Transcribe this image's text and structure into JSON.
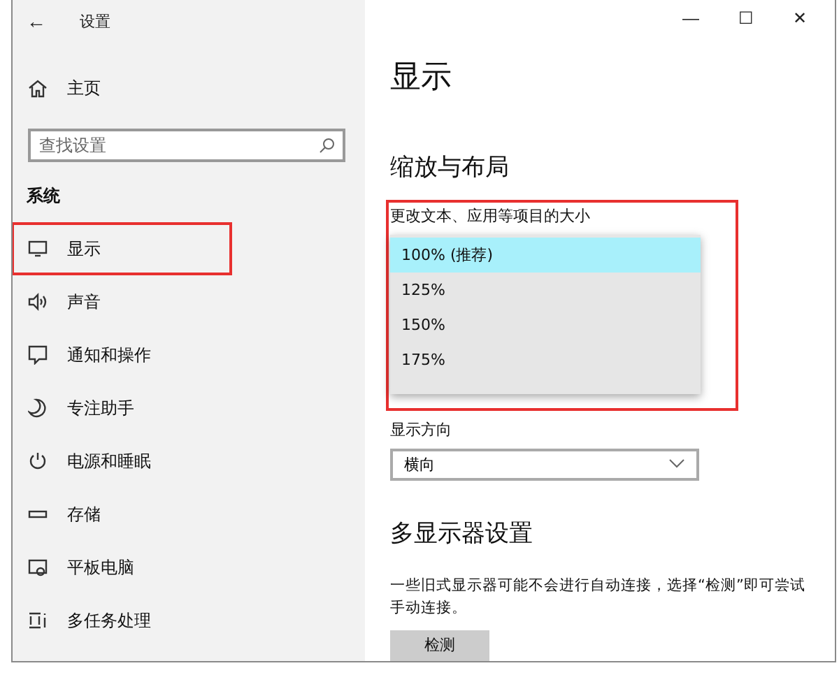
{
  "window": {
    "title": "设置",
    "back": "←",
    "controls": [
      "—",
      "☐",
      "✕"
    ]
  },
  "sidebar": {
    "home": "主页",
    "search": {
      "placeholder": "查找设置"
    },
    "section": "系统",
    "items": [
      {
        "label": "显示",
        "kind": "monitor",
        "highlighted": true
      },
      {
        "label": "声音",
        "kind": "speaker",
        "highlighted": false
      },
      {
        "label": "通知和操作",
        "kind": "message",
        "highlighted": false
      },
      {
        "label": "专注助手",
        "kind": "moon",
        "highlighted": false
      },
      {
        "label": "电源和睡眠",
        "kind": "power",
        "highlighted": false
      },
      {
        "label": "存储",
        "kind": "storage",
        "highlighted": false
      },
      {
        "label": "平板电脑",
        "kind": "tablet",
        "highlighted": false
      },
      {
        "label": "多任务处理",
        "kind": "multitask",
        "highlighted": false
      }
    ]
  },
  "page": {
    "title": "显示",
    "scale_section": {
      "heading": "缩放与布局",
      "label": "更改文本、应用等项目的大小",
      "highlighted": true,
      "options": [
        {
          "label": "100% (推荐)",
          "selected": true
        },
        {
          "label": "125%",
          "selected": false
        },
        {
          "label": "150%",
          "selected": false
        },
        {
          "label": "175%",
          "selected": false
        }
      ]
    },
    "orientation": {
      "label": "显示方向",
      "value": "横向"
    },
    "multi_display": {
      "heading": "多显示器设置",
      "text": "一些旧式显示器可能不会进行自动连接，选择“检测”即可尝试手动连接。",
      "button": "检测"
    }
  }
}
